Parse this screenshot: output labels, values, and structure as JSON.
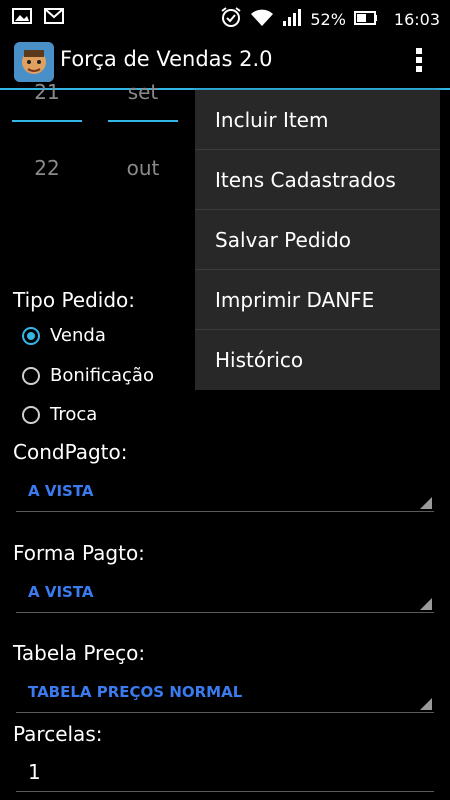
{
  "statusbar": {
    "battery": "52%",
    "time": "16:03"
  },
  "actionbar": {
    "title": "Força de Vendas 2.0"
  },
  "date_picker": {
    "day_prev": "21",
    "month_prev": "set",
    "day_next": "22",
    "month_next": "out"
  },
  "form": {
    "tipo_pedido_label": "Tipo Pedido:",
    "tipo_options": [
      "Venda",
      "Bonificação",
      "Troca"
    ],
    "tipo_selected": "Venda",
    "cond_pagto_label": "CondPagto:",
    "cond_pagto_value": "A VISTA",
    "forma_pagto_label": "Forma Pagto:",
    "forma_pagto_value": "A VISTA",
    "tabela_preco_label": "Tabela Preço:",
    "tabela_preco_value": "TABELA PREÇOS NORMAL",
    "parcelas_label": "Parcelas:",
    "parcelas_value": "1"
  },
  "menu": {
    "items": [
      "Incluir Item",
      "Itens Cadastrados",
      "Salvar Pedido",
      "Imprimir DANFE",
      "Histórico"
    ]
  },
  "colors": {
    "accent": "#33b5e5",
    "spinner_text": "#3b7bf0",
    "menu_bg": "#282828"
  }
}
